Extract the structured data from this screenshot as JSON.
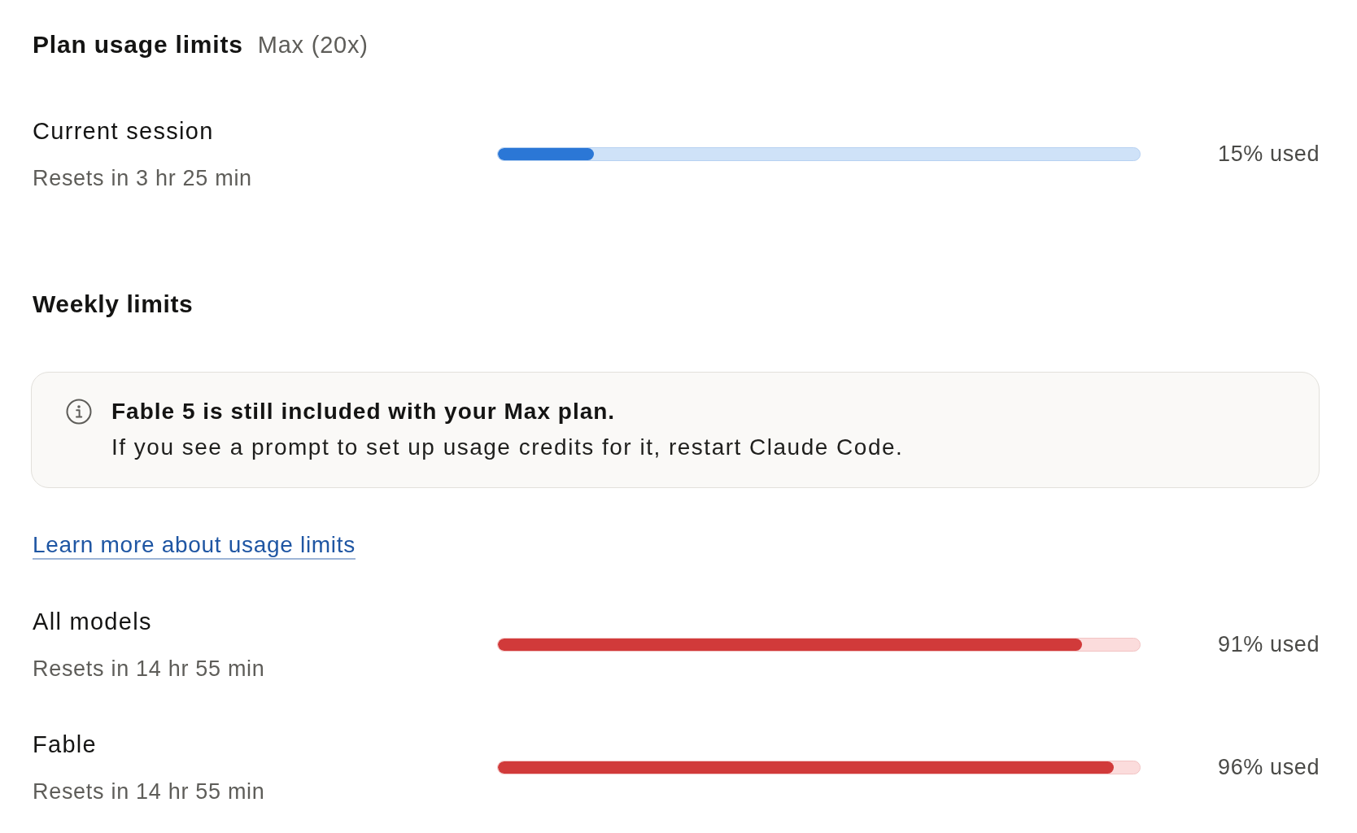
{
  "title": "Plan usage limits",
  "plan": "Max (20x)",
  "current_session": {
    "name": "Current session",
    "resets": "Resets in 3 hr 25 min",
    "level": 0.15,
    "reading": "15% used",
    "kind": "normal"
  },
  "weekly": {
    "title": "Weekly limits",
    "notice": {
      "heading": "Fable 5 is still included with your Max plan.",
      "text": "If you see a prompt to set up usage credits for it, restart Claude Code."
    },
    "link": "Learn more about usage limits",
    "limits": [
      {
        "name": "All models",
        "resets": "Resets in 14 hr 55 min",
        "level": 0.91,
        "reading": "91% used",
        "kind": "critical"
      },
      {
        "name": "Fable",
        "resets": "Resets in 14 hr 55 min",
        "level": 0.96,
        "reading": "96% used",
        "kind": "critical"
      }
    ]
  }
}
